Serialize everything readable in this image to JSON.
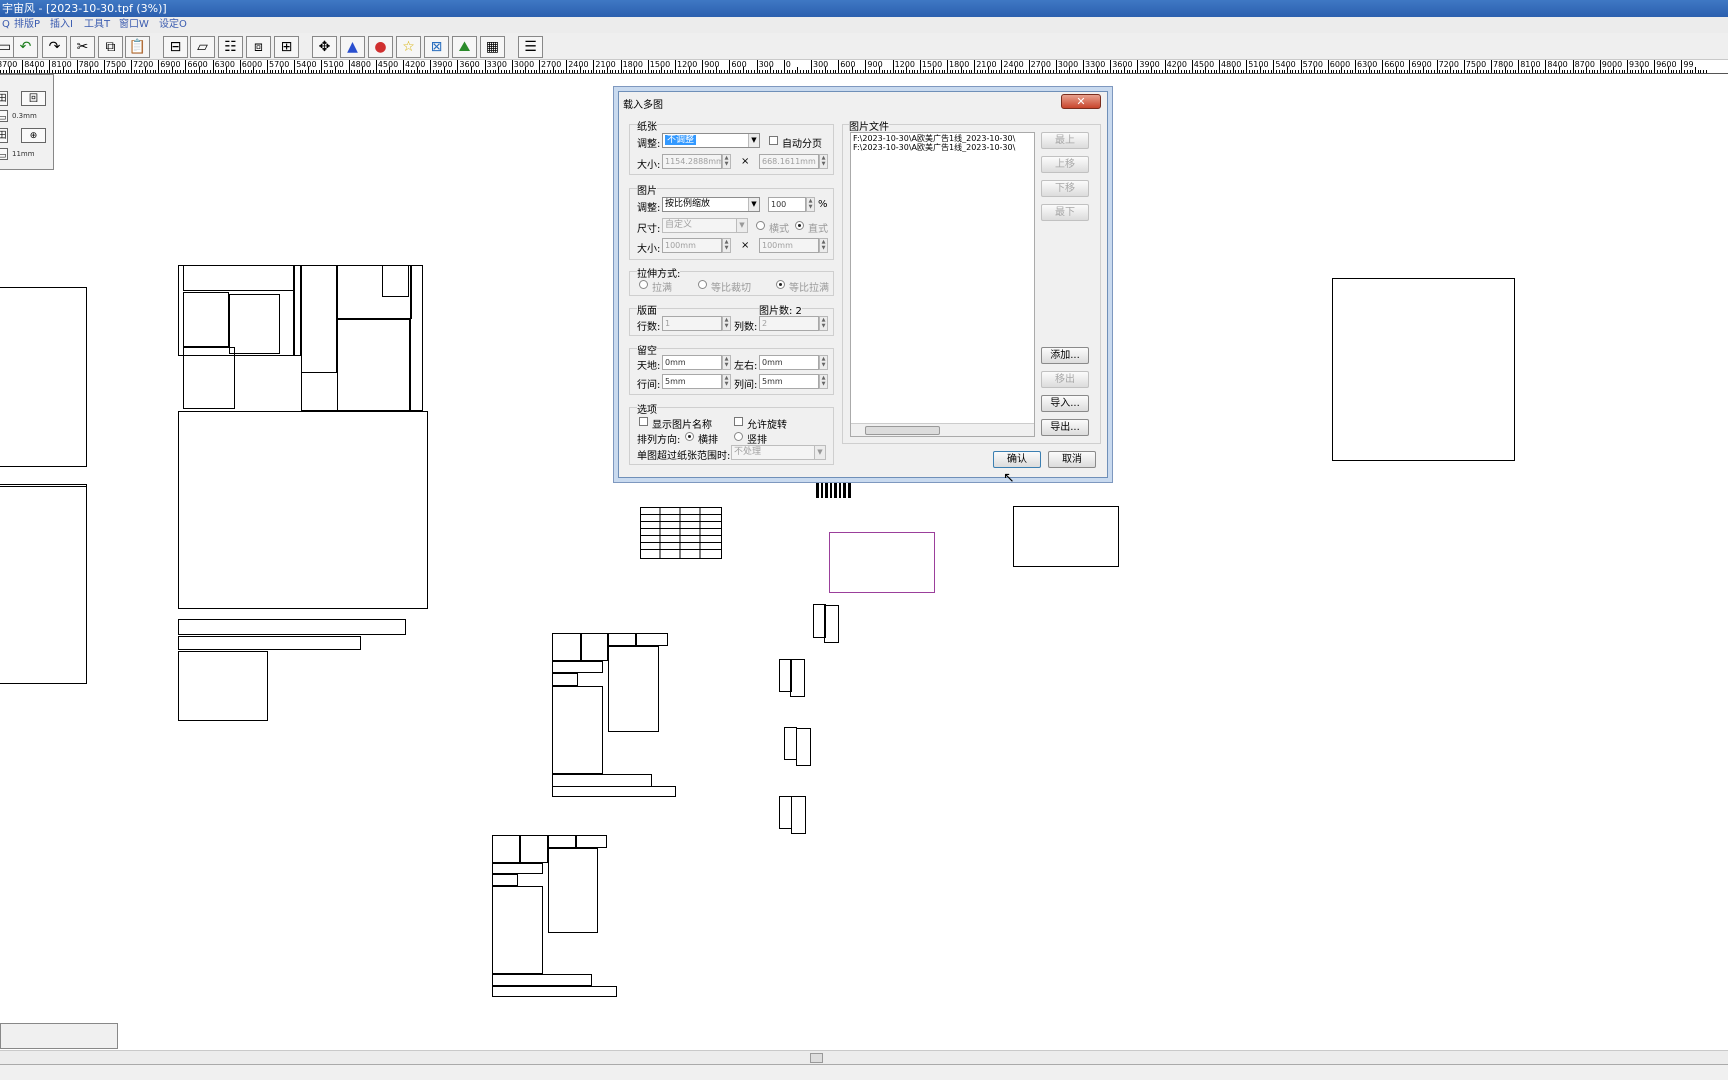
{
  "window": {
    "title": "宇宙风 - [2023-10-30.tpf (3%)]"
  },
  "menu": [
    "Q",
    "排版P",
    "插入I",
    "工具T",
    "窗口W",
    "设定O"
  ],
  "ruler_labels": [
    "8700",
    "8400",
    "8100",
    "7800",
    "7500",
    "7200",
    "6900",
    "6600",
    "6300",
    "6000",
    "5700",
    "5400",
    "5100",
    "4800",
    "4500",
    "4200",
    "3900",
    "3600",
    "3300",
    "3000",
    "2700",
    "2400",
    "2100",
    "1800",
    "1500",
    "1200",
    "900",
    "600",
    "300",
    "0",
    "300",
    "600",
    "900",
    "1200",
    "1500",
    "1800",
    "2100",
    "2400",
    "2700",
    "3000",
    "3300",
    "3600",
    "3900",
    "4200",
    "4500",
    "4800",
    "5100",
    "5400",
    "5700",
    "6000",
    "6300",
    "6600",
    "6900",
    "7200",
    "7500",
    "7800",
    "8100",
    "8400",
    "8700",
    "9000",
    "9300",
    "9600",
    "99"
  ],
  "panel": {
    "value1": "0.3mm",
    "value2": "11mm"
  },
  "dialog": {
    "title": "载入多图",
    "close_label": "✕",
    "paper": {
      "group": "纸张",
      "adjust_label": "调整:",
      "adjust_value": "不调整",
      "auto_page_label": "自动分页",
      "size_label": "大小:",
      "width": "1154.2888mm",
      "height": "668.1611mm",
      "times": "×"
    },
    "image": {
      "group": "图片",
      "adjust_label": "调整:",
      "adjust_value": "按比例缩放",
      "percent_value": "100",
      "percent_unit": "%",
      "dim_label": "尺寸:",
      "dim_value": "自定义",
      "landscape_label": "横式",
      "portrait_label": "直式",
      "size_label": "大小:",
      "width": "100mm",
      "height": "100mm",
      "times": "×"
    },
    "stretch": {
      "group": "拉伸方式:",
      "opt1": "拉满",
      "opt2": "等比裁切",
      "opt3": "等比拉满"
    },
    "layout": {
      "group": "版面",
      "count_label": "图片数: 2",
      "rows_label": "行数:",
      "rows_value": "1",
      "cols_label": "列数:",
      "cols_value": "2"
    },
    "margin": {
      "group": "留空",
      "top_bottom_label": "天地:",
      "top_bottom_value": "0mm",
      "left_right_label": "左右:",
      "left_right_value": "0mm",
      "row_gap_label": "行间:",
      "row_gap_value": "5mm",
      "col_gap_label": "列间:",
      "col_gap_value": "5mm"
    },
    "options": {
      "group": "选项",
      "show_name_label": "显示图片名称",
      "allow_rotate_label": "允许旋转",
      "direction_label": "排列方向:",
      "horizontal_label": "横排",
      "vertical_label": "竖排",
      "overflow_label": "单图超过纸张范围时:",
      "overflow_value": "不处理"
    },
    "files": {
      "group": "图片文件",
      "items": [
        "F:\\2023-10-30\\A欧美广告1线_2023-10-30\\",
        "F:\\2023-10-30\\A欧美广告1线_2023-10-30\\"
      ]
    },
    "buttons": {
      "top": "最上",
      "up": "上移",
      "down": "下移",
      "bottom": "最下",
      "add": "添加...",
      "remove": "移出",
      "import": "导入...",
      "export": "导出...",
      "ok": "确认",
      "cancel": "取消"
    }
  }
}
